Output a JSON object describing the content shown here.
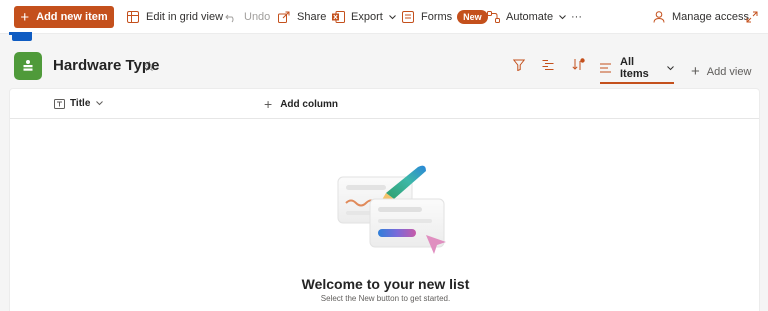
{
  "commandbar": {
    "add_new_item": "Add new item",
    "edit_grid": "Edit in grid view",
    "undo": "Undo",
    "share": "Share",
    "export": "Export",
    "forms": "Forms",
    "forms_badge": "New",
    "automate": "Automate",
    "more": "···",
    "manage_access": "Manage access"
  },
  "list": {
    "title": "Hardware Type",
    "icon": "list-icon",
    "view": "All Items",
    "add_view": "Add view"
  },
  "columns": {
    "title": "Title",
    "add_column": "Add column"
  },
  "empty_state": {
    "heading": "Welcome to your new list",
    "subtext": "Select the New button to get started."
  },
  "colors": {
    "accent": "#c4501c",
    "list_icon": "#4f9a3a"
  }
}
